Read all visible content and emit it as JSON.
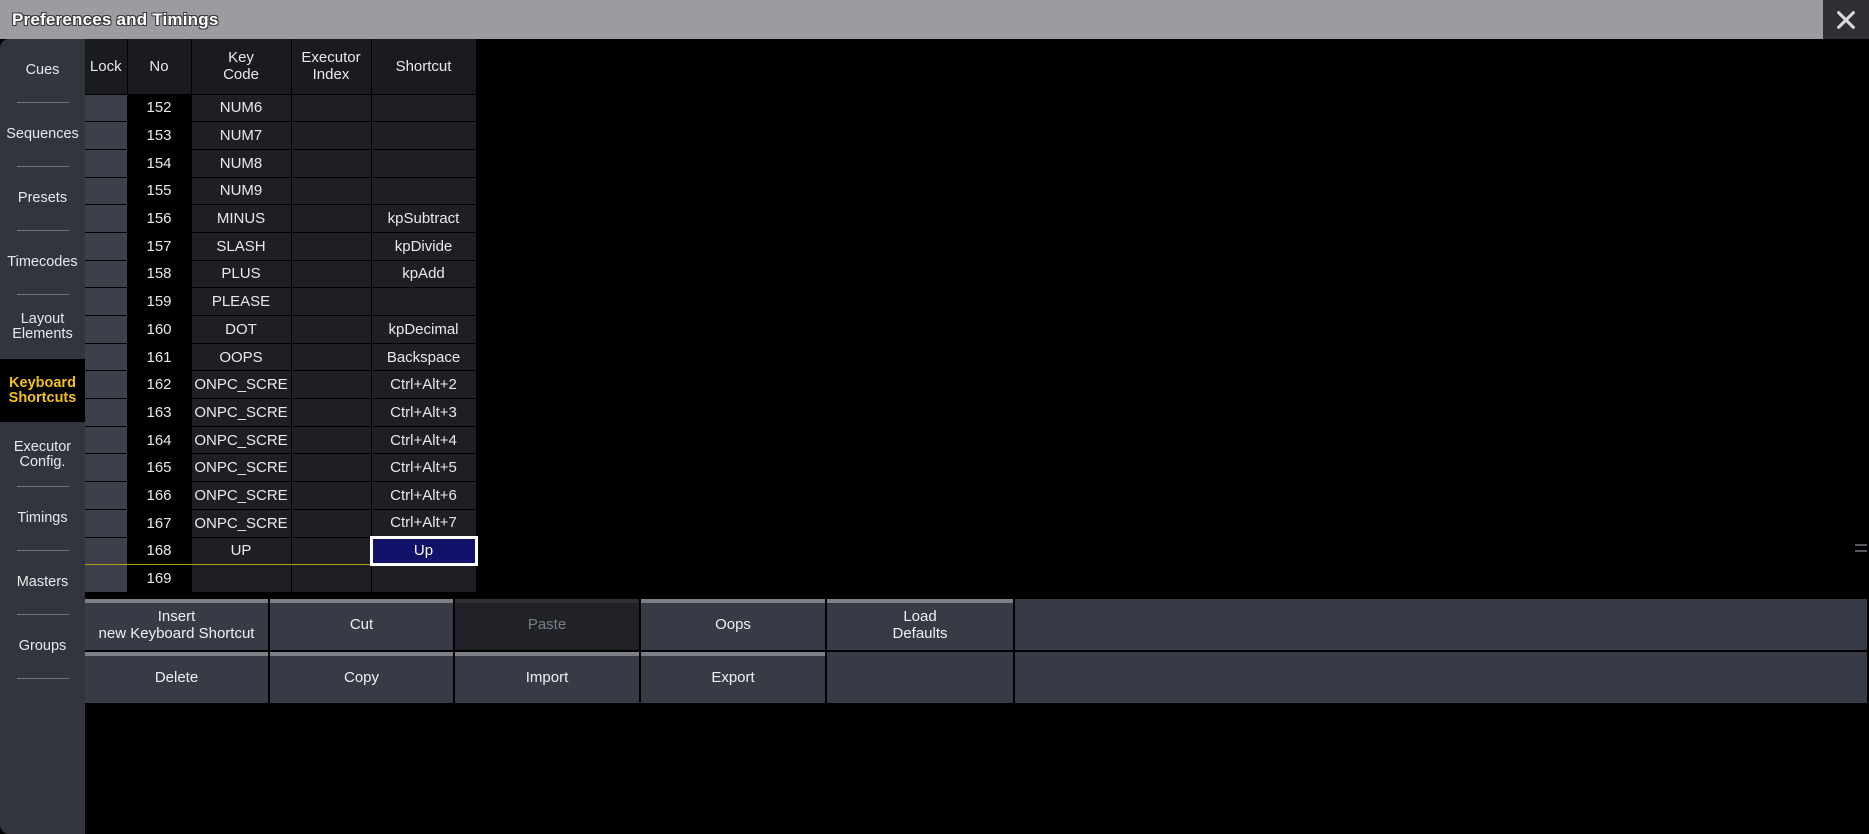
{
  "window": {
    "title": "Preferences and Timings",
    "close_icon": "close-icon"
  },
  "sidebar": {
    "items": [
      {
        "label": "Cues",
        "active": false
      },
      {
        "label": "Sequences",
        "active": false
      },
      {
        "label": "Presets",
        "active": false
      },
      {
        "label": "Timecodes",
        "active": false
      },
      {
        "label": "Layout\nElements",
        "active": false
      },
      {
        "label": "Keyboard\nShortcuts",
        "active": true
      },
      {
        "label": "Executor\nConfig.",
        "active": false
      },
      {
        "label": "Timings",
        "active": false
      },
      {
        "label": "Masters",
        "active": false
      },
      {
        "label": "Groups",
        "active": false
      },
      {
        "label": "",
        "active": false
      }
    ]
  },
  "table": {
    "columns": [
      {
        "key": "lock",
        "label": "Lock"
      },
      {
        "key": "no",
        "label": "No"
      },
      {
        "key": "key_code",
        "label": "Key\nCode"
      },
      {
        "key": "executor_index",
        "label": "Executor\nIndex"
      },
      {
        "key": "shortcut",
        "label": "Shortcut"
      }
    ],
    "rows": [
      {
        "no": "152",
        "key_code": "NUM6",
        "executor_index": "",
        "shortcut": "",
        "selected": false,
        "focused": false
      },
      {
        "no": "153",
        "key_code": "NUM7",
        "executor_index": "",
        "shortcut": "",
        "selected": false,
        "focused": false
      },
      {
        "no": "154",
        "key_code": "NUM8",
        "executor_index": "",
        "shortcut": "",
        "selected": false,
        "focused": false
      },
      {
        "no": "155",
        "key_code": "NUM9",
        "executor_index": "",
        "shortcut": "",
        "selected": false,
        "focused": false
      },
      {
        "no": "156",
        "key_code": "MINUS",
        "executor_index": "",
        "shortcut": "kpSubtract",
        "selected": false,
        "focused": false
      },
      {
        "no": "157",
        "key_code": "SLASH",
        "executor_index": "",
        "shortcut": "kpDivide",
        "selected": false,
        "focused": false
      },
      {
        "no": "158",
        "key_code": "PLUS",
        "executor_index": "",
        "shortcut": "kpAdd",
        "selected": false,
        "focused": false
      },
      {
        "no": "159",
        "key_code": "PLEASE",
        "executor_index": "",
        "shortcut": "",
        "selected": false,
        "focused": false
      },
      {
        "no": "160",
        "key_code": "DOT",
        "executor_index": "",
        "shortcut": "kpDecimal",
        "selected": false,
        "focused": false
      },
      {
        "no": "161",
        "key_code": "OOPS",
        "executor_index": "",
        "shortcut": "Backspace",
        "selected": false,
        "focused": false
      },
      {
        "no": "162",
        "key_code": "ONPC_SCRE",
        "executor_index": "",
        "shortcut": "Ctrl+Alt+2",
        "selected": false,
        "focused": false
      },
      {
        "no": "163",
        "key_code": "ONPC_SCRE",
        "executor_index": "",
        "shortcut": "Ctrl+Alt+3",
        "selected": false,
        "focused": false
      },
      {
        "no": "164",
        "key_code": "ONPC_SCRE",
        "executor_index": "",
        "shortcut": "Ctrl+Alt+4",
        "selected": false,
        "focused": false
      },
      {
        "no": "165",
        "key_code": "ONPC_SCRE",
        "executor_index": "",
        "shortcut": "Ctrl+Alt+5",
        "selected": false,
        "focused": false
      },
      {
        "no": "166",
        "key_code": "ONPC_SCRE",
        "executor_index": "",
        "shortcut": "Ctrl+Alt+6",
        "selected": false,
        "focused": false
      },
      {
        "no": "167",
        "key_code": "ONPC_SCRE",
        "executor_index": "",
        "shortcut": "Ctrl+Alt+7",
        "selected": false,
        "focused": false
      },
      {
        "no": "168",
        "key_code": "UP",
        "executor_index": "",
        "shortcut": "Up",
        "selected": true,
        "focused": true
      },
      {
        "no": "169",
        "key_code": "",
        "executor_index": "",
        "shortcut": "",
        "selected": false,
        "focused": false
      }
    ]
  },
  "buttons": {
    "row1": [
      {
        "label": "Insert\nnew Keyboard Shortcut",
        "state": "normal"
      },
      {
        "label": "Cut",
        "state": "normal"
      },
      {
        "label": "Paste",
        "state": "disabled"
      },
      {
        "label": "Oops",
        "state": "normal"
      },
      {
        "label": "Load\nDefaults",
        "state": "normal"
      },
      {
        "label": "",
        "state": "blank"
      }
    ],
    "row2": [
      {
        "label": "Delete",
        "state": "normal"
      },
      {
        "label": "Copy",
        "state": "normal"
      },
      {
        "label": "Import",
        "state": "normal"
      },
      {
        "label": "Export",
        "state": "normal"
      },
      {
        "label": "",
        "state": "blank"
      },
      {
        "label": "",
        "state": "blank"
      }
    ]
  },
  "colors": {
    "accent_selection": "#b99a18",
    "focus_fill": "#12126b",
    "focus_border": "#ffffff",
    "active_nav_text": "#f3c018",
    "titlebar": "#9a9ca1"
  }
}
